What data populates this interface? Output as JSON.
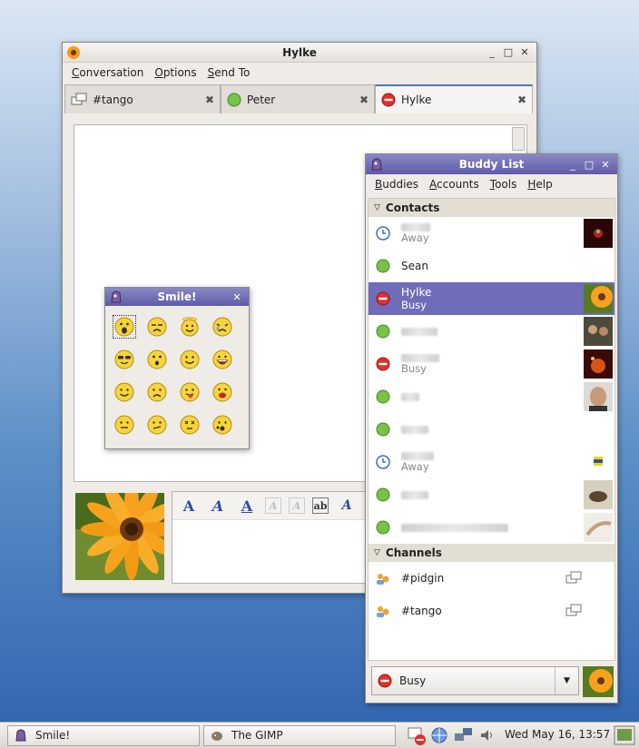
{
  "chat_window": {
    "title": "Hylke",
    "menu": [
      "Conversation",
      "Options",
      "Send To"
    ],
    "tabs": [
      {
        "label": "#tango",
        "icon": "chat-icon"
      },
      {
        "label": "Peter",
        "icon": "available-icon"
      },
      {
        "label": "Hylke",
        "icon": "busy-icon"
      }
    ]
  },
  "smile_dialog": {
    "title": "Smile!"
  },
  "buddy_list": {
    "title": "Buddy List",
    "menu": [
      "Buddies",
      "Accounts",
      "Tools",
      "Help"
    ],
    "groups": {
      "contacts": "Contacts",
      "channels": "Channels"
    },
    "contacts": [
      {
        "name": "",
        "sub": "Away",
        "status": "away"
      },
      {
        "name": "Sean",
        "sub": "",
        "status": "available"
      },
      {
        "name": "Hylke",
        "sub": "Busy",
        "status": "busy"
      },
      {
        "name": "",
        "sub": "",
        "status": "available"
      },
      {
        "name": "",
        "sub": "Busy",
        "status": "busy"
      },
      {
        "name": "",
        "sub": "",
        "status": "available"
      },
      {
        "name": "",
        "sub": "",
        "status": "available"
      },
      {
        "name": "",
        "sub": "Away",
        "status": "away"
      },
      {
        "name": "",
        "sub": "",
        "status": "available"
      },
      {
        "name": "",
        "sub": "",
        "status": "available"
      }
    ],
    "channels": [
      "#pidgin",
      "#tango"
    ],
    "status_selector": "Busy"
  },
  "taskbar": {
    "tasks": [
      "Smile!",
      "The GIMP"
    ],
    "clock": "Wed May 16, 13:57"
  }
}
